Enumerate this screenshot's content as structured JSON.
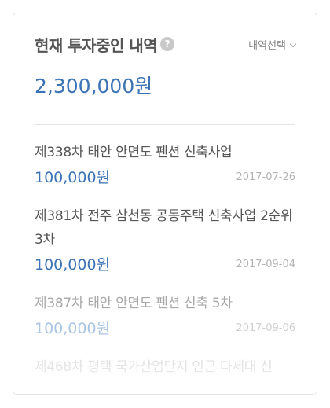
{
  "header": {
    "title": "현재 투자중인 내역",
    "help_icon": "?",
    "select_label": "내역선택"
  },
  "total_amount": "2,300,000원",
  "investments": [
    {
      "title": "제338차 태안 안면도 펜션 신축사업",
      "amount": "100,000원",
      "date": "2017-07-26"
    },
    {
      "title": "제381차 전주 삼천동 공동주택 신축사업 2순위 3차",
      "amount": "100,000원",
      "date": "2017-09-04"
    },
    {
      "title": "제387차 태안 안면도 펜션 신축 5차",
      "amount": "100,000원",
      "date": "2017-09-06"
    },
    {
      "title": "제468차 평택 국가산업단지 인근 다세대 신"
    }
  ],
  "colors": {
    "accent": "#3b73b6",
    "text": "#555555",
    "date": "#b3b3b3"
  }
}
